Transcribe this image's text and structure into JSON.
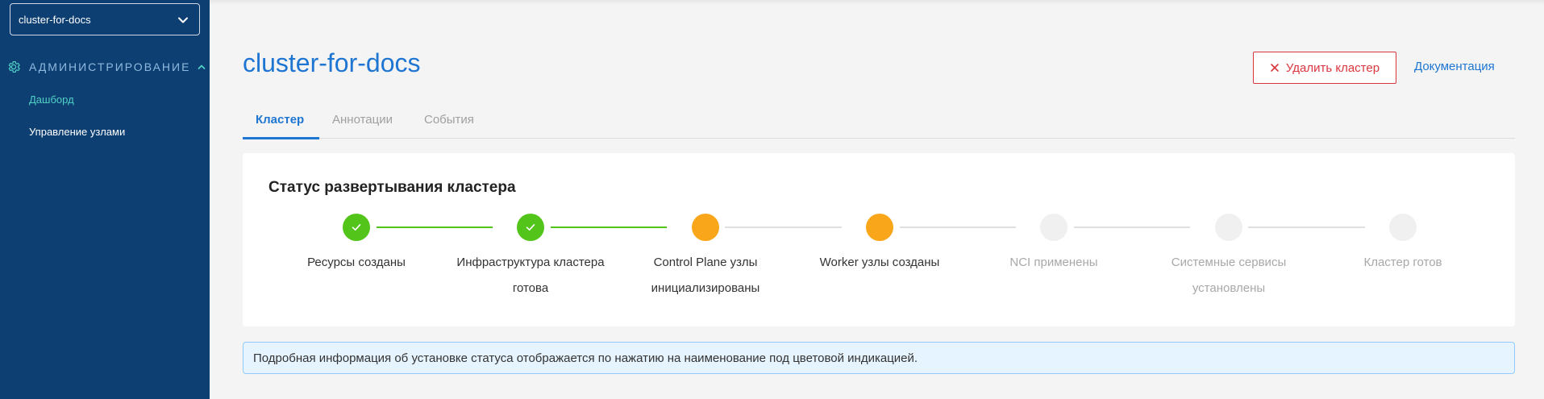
{
  "sidebar": {
    "cluster_select": {
      "value": "cluster-for-docs"
    },
    "section": {
      "label": "АДМИНИСТРИРОВАНИЕ",
      "icon": "gear-icon"
    },
    "items": [
      {
        "label": "Дашборд",
        "active": true
      },
      {
        "label": "Управление узлами",
        "active": false
      }
    ]
  },
  "header": {
    "title": "cluster-for-docs",
    "delete_button": "Удалить кластер",
    "docs_link": "Документация"
  },
  "tabs": [
    {
      "label": "Кластер",
      "active": true
    },
    {
      "label": "Аннотации",
      "active": false
    },
    {
      "label": "События",
      "active": false
    }
  ],
  "status_card": {
    "title": "Статус развертывания кластера",
    "steps": [
      {
        "label": "Ресурсы созданы",
        "state": "done"
      },
      {
        "label": "Инфраструктура кластера готова",
        "state": "done"
      },
      {
        "label": "Control Plane узлы инициализированы",
        "state": "in-progress"
      },
      {
        "label": "Worker узлы созданы",
        "state": "in-progress"
      },
      {
        "label": "NCI применены",
        "state": "pending"
      },
      {
        "label": "Системные сервисы установлены",
        "state": "pending"
      },
      {
        "label": "Кластер готов",
        "state": "pending"
      }
    ]
  },
  "info_message": "Подробная информация об установке статуса отображается по нажатию на наименование под цветовой индикацией.",
  "colors": {
    "sidebar_bg": "#0e3f73",
    "accent": "#1f76d2",
    "danger": "#d9363e",
    "done": "#52c41a",
    "in_progress": "#faa61a",
    "pending": "#f0f0f0",
    "active_nav": "#4fd1c5"
  }
}
